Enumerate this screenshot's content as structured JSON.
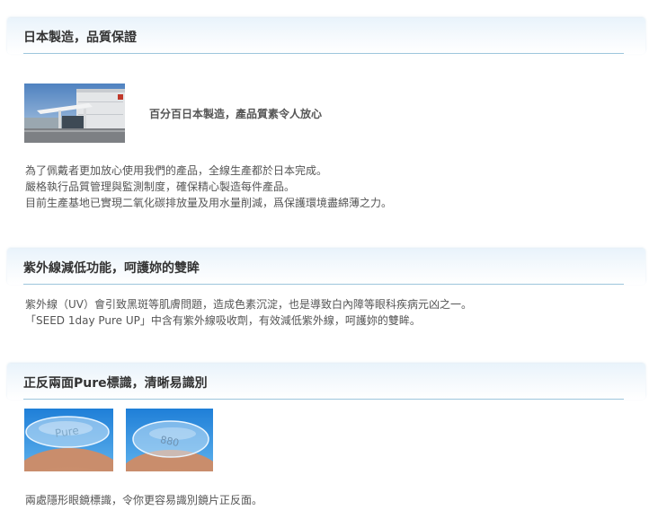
{
  "sections": [
    {
      "title": "日本製造，品質保證",
      "caption": "百分百日本製造，產品質素令人放心",
      "lines": [
        "為了佩戴者更加放心使用我們的產品，全線生產都於日本完成。",
        "嚴格執行品質管理與監測制度，確保精心製造每件產品。",
        "目前生產基地已實現二氧化碳排放量及用水量削減，爲保護環境盡綿薄之力。"
      ]
    },
    {
      "title": "紫外線減低功能，呵護妳的雙眸",
      "lines": [
        "紫外線（UV）會引致黑斑等肌膚問題，造成色素沉淀，也是導致白內障等眼科疾病元凶之一。",
        "「SEED 1day Pure UP」中含有紫外線吸收劑，有效減低紫外線，呵護妳的雙眸。"
      ]
    },
    {
      "title": "正反兩面Pure標識，清晰易識別",
      "lines": [
        "兩處隱形眼鏡標識，令你更容易識別鏡片正反面。"
      ],
      "lens_marks": [
        "Pure",
        "880"
      ]
    }
  ],
  "colors": {
    "header_gradient_top": "#e9f3fb",
    "header_rule": "#9ec6dc",
    "title_text": "#333333",
    "body_text": "#555555"
  }
}
